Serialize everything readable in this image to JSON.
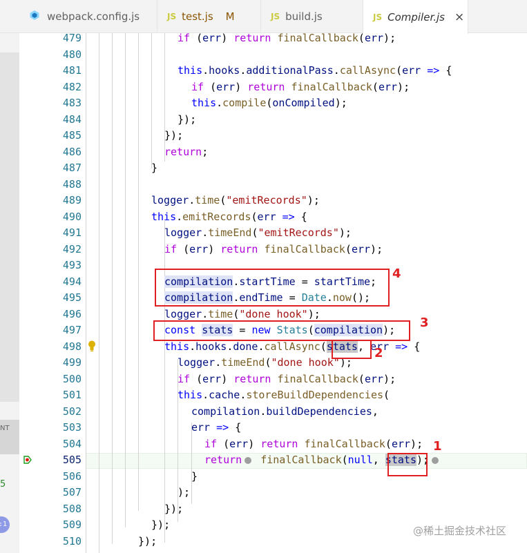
{
  "tabs": [
    {
      "label": "webpack.config.js",
      "icon": "webpack-icon"
    },
    {
      "label": "test.js",
      "icon": "js-icon",
      "status": "M"
    },
    {
      "label": "build.js",
      "icon": "js-icon"
    },
    {
      "label": "Compiler.js",
      "icon": "js-icon",
      "active": true,
      "close": "×"
    }
  ],
  "js_badge": "JS",
  "side_strip": {
    "label_nt": "NT",
    "label_5": "5",
    "badge": ":1"
  },
  "line_numbers": [
    "479",
    "480",
    "481",
    "482",
    "483",
    "484",
    "485",
    "486",
    "487",
    "488",
    "489",
    "490",
    "491",
    "492",
    "493",
    "494",
    "495",
    "496",
    "497",
    "498",
    "499",
    "500",
    "501",
    "502",
    "503",
    "504",
    "505",
    "506",
    "507",
    "508",
    "509",
    "510"
  ],
  "current_line": "505",
  "code_lines": [
    "if (err) return finalCallback(err);",
    "",
    "this.hooks.additionalPass.callAsync(err => {",
    "if (err) return finalCallback(err);",
    "this.compile(onCompiled);",
    "});",
    "});",
    "return;",
    "}",
    "",
    "logger.time(\"emitRecords\");",
    "this.emitRecords(err => {",
    "logger.timeEnd(\"emitRecords\");",
    "if (err) return finalCallback(err);",
    "",
    "compilation.startTime = startTime;",
    "compilation.endTime = Date.now();",
    "logger.time(\"done hook\");",
    "const stats = new Stats(compilation);",
    "this.hooks.done.callAsync(stats, err => {",
    "logger.timeEnd(\"done hook\");",
    "if (err) return finalCallback(err);",
    "this.cache.storeBuildDependencies(",
    "compilation.buildDependencies,",
    "err => {",
    "if (err) return finalCallback(err);",
    "return finalCallback(null, stats);",
    "}",
    ");",
    "});",
    "});",
    "});"
  ],
  "annotations": [
    "4",
    "3",
    "2",
    "1"
  ],
  "watermark": "@稀土掘金技术社区",
  "colors": {
    "keyword": "#0000ff",
    "control": "#af00db",
    "string": "#a31515",
    "function": "#795e26",
    "variable": "#001080",
    "type": "#267f99",
    "annotation": "#e02020"
  }
}
